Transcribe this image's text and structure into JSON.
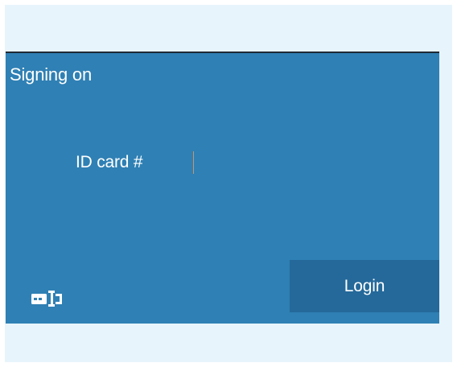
{
  "panel": {
    "title": "Signing on"
  },
  "id_field": {
    "label": "ID card #",
    "value": ""
  },
  "login_button": {
    "label": "Login"
  },
  "icons": {
    "card_reader": "id-card-reader-icon"
  },
  "colors": {
    "page_background": "#e8f4fb",
    "panel_background": "#2f80b4",
    "login_button_background": "#24699a",
    "text": "#ffffff",
    "caret": "#c8956b"
  }
}
